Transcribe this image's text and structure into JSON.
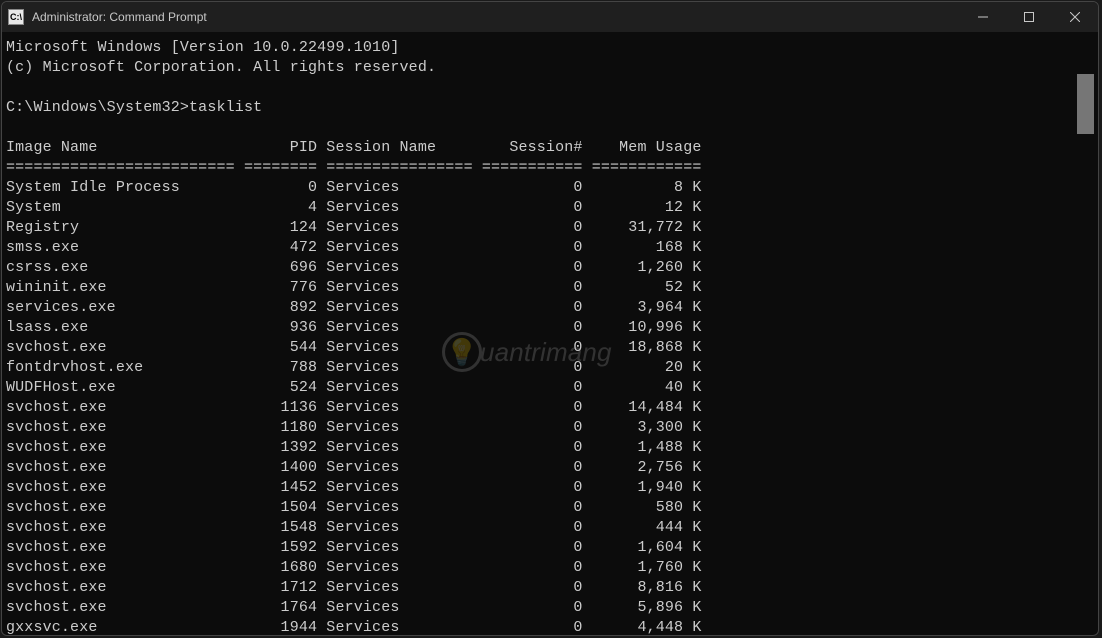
{
  "titlebar": {
    "icon_text": "C:\\",
    "title": "Administrator: Command Prompt"
  },
  "terminal": {
    "version_line": "Microsoft Windows [Version 10.0.22499.1010]",
    "copyright_line": "(c) Microsoft Corporation. All rights reserved.",
    "prompt_path": "C:\\Windows\\System32>",
    "command": "tasklist",
    "headers": {
      "image_name": "Image Name",
      "pid": "PID",
      "session_name": "Session Name",
      "session_num": "Session#",
      "mem_usage": "Mem Usage"
    },
    "separator": {
      "c1": "=========================",
      "c2": "========",
      "c3": "================",
      "c4": "===========",
      "c5": "============"
    },
    "rows": [
      {
        "name": "System Idle Process",
        "pid": "0",
        "sess": "Services",
        "snum": "0",
        "mem": "8 K"
      },
      {
        "name": "System",
        "pid": "4",
        "sess": "Services",
        "snum": "0",
        "mem": "12 K"
      },
      {
        "name": "Registry",
        "pid": "124",
        "sess": "Services",
        "snum": "0",
        "mem": "31,772 K"
      },
      {
        "name": "smss.exe",
        "pid": "472",
        "sess": "Services",
        "snum": "0",
        "mem": "168 K"
      },
      {
        "name": "csrss.exe",
        "pid": "696",
        "sess": "Services",
        "snum": "0",
        "mem": "1,260 K"
      },
      {
        "name": "wininit.exe",
        "pid": "776",
        "sess": "Services",
        "snum": "0",
        "mem": "52 K"
      },
      {
        "name": "services.exe",
        "pid": "892",
        "sess": "Services",
        "snum": "0",
        "mem": "3,964 K"
      },
      {
        "name": "lsass.exe",
        "pid": "936",
        "sess": "Services",
        "snum": "0",
        "mem": "10,996 K"
      },
      {
        "name": "svchost.exe",
        "pid": "544",
        "sess": "Services",
        "snum": "0",
        "mem": "18,868 K"
      },
      {
        "name": "fontdrvhost.exe",
        "pid": "788",
        "sess": "Services",
        "snum": "0",
        "mem": "20 K"
      },
      {
        "name": "WUDFHost.exe",
        "pid": "524",
        "sess": "Services",
        "snum": "0",
        "mem": "40 K"
      },
      {
        "name": "svchost.exe",
        "pid": "1136",
        "sess": "Services",
        "snum": "0",
        "mem": "14,484 K"
      },
      {
        "name": "svchost.exe",
        "pid": "1180",
        "sess": "Services",
        "snum": "0",
        "mem": "3,300 K"
      },
      {
        "name": "svchost.exe",
        "pid": "1392",
        "sess": "Services",
        "snum": "0",
        "mem": "1,488 K"
      },
      {
        "name": "svchost.exe",
        "pid": "1400",
        "sess": "Services",
        "snum": "0",
        "mem": "2,756 K"
      },
      {
        "name": "svchost.exe",
        "pid": "1452",
        "sess": "Services",
        "snum": "0",
        "mem": "1,940 K"
      },
      {
        "name": "svchost.exe",
        "pid": "1504",
        "sess": "Services",
        "snum": "0",
        "mem": "580 K"
      },
      {
        "name": "svchost.exe",
        "pid": "1548",
        "sess": "Services",
        "snum": "0",
        "mem": "444 K"
      },
      {
        "name": "svchost.exe",
        "pid": "1592",
        "sess": "Services",
        "snum": "0",
        "mem": "1,604 K"
      },
      {
        "name": "svchost.exe",
        "pid": "1680",
        "sess": "Services",
        "snum": "0",
        "mem": "1,760 K"
      },
      {
        "name": "svchost.exe",
        "pid": "1712",
        "sess": "Services",
        "snum": "0",
        "mem": "8,816 K"
      },
      {
        "name": "svchost.exe",
        "pid": "1764",
        "sess": "Services",
        "snum": "0",
        "mem": "5,896 K"
      },
      {
        "name": "gxxsvc.exe",
        "pid": "1944",
        "sess": "Services",
        "snum": "0",
        "mem": "4,448 K"
      }
    ]
  },
  "watermark": {
    "text": "uantrimang"
  }
}
